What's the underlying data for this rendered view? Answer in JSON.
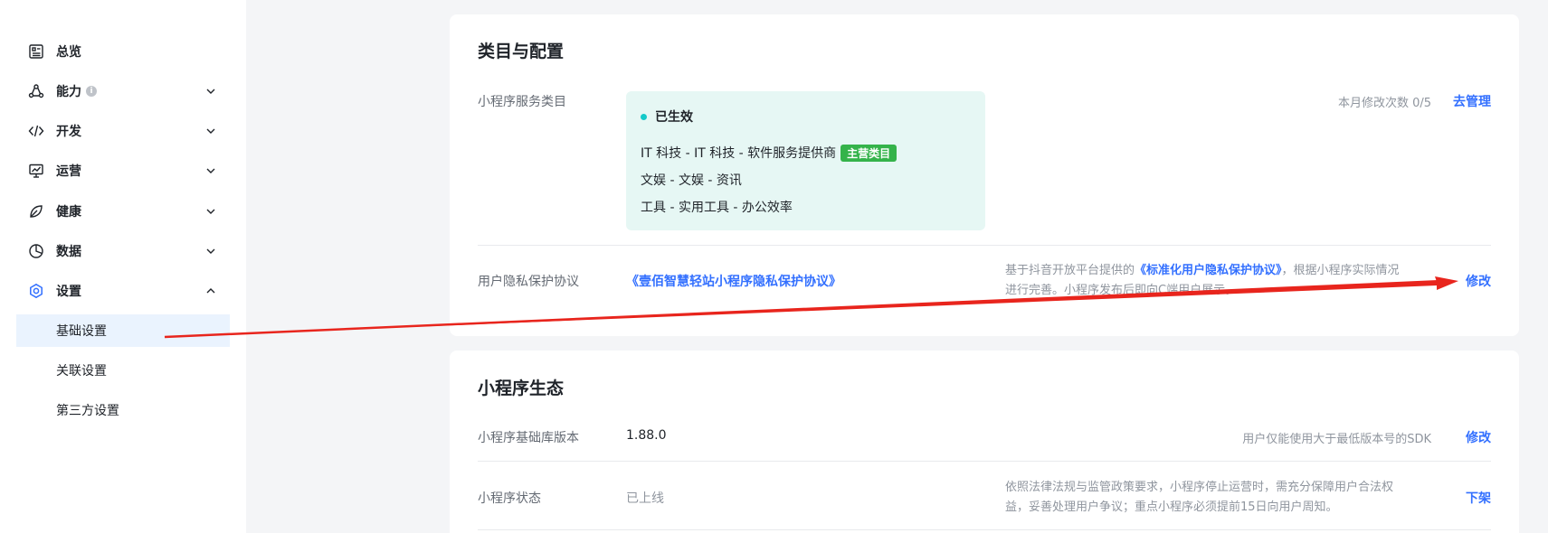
{
  "sidebar": {
    "items": [
      {
        "label": "总览",
        "icon": "dashboard-icon"
      },
      {
        "label": "能力",
        "icon": "capability-icon",
        "info": "i"
      },
      {
        "label": "开发",
        "icon": "code-icon"
      },
      {
        "label": "运营",
        "icon": "operation-icon"
      },
      {
        "label": "健康",
        "icon": "health-icon"
      },
      {
        "label": "数据",
        "icon": "pie-chart-icon"
      },
      {
        "label": "设置",
        "icon": "gear-icon"
      }
    ],
    "sub_items": [
      {
        "label": "基础设置",
        "active": true
      },
      {
        "label": "关联设置"
      },
      {
        "label": "第三方设置"
      }
    ]
  },
  "category_card": {
    "title": "类目与配置",
    "service_category": {
      "label": "小程序服务类目",
      "status": "已生效",
      "lines": [
        {
          "text": "IT 科技 - IT 科技 - 软件服务提供商",
          "badge": "主营类目"
        },
        {
          "text": "文娱 - 文娱 - 资讯"
        },
        {
          "text": "工具 - 实用工具 - 办公效率"
        }
      ],
      "monthly_changes": "本月修改次数 0/5",
      "action": "去管理"
    },
    "privacy": {
      "label": "用户隐私保护协议",
      "link": "《壹佰智慧轻站小程序隐私保护协议》",
      "desc_prefix": "基于抖音开放平台提供的",
      "desc_link": "《标准化用户隐私保护协议》",
      "desc_suffix": "，根据小程序实际情况",
      "desc_line2": "进行完善。小程序发布后即向C端用户展示。",
      "action": "修改"
    }
  },
  "ecosystem_card": {
    "title": "小程序生态",
    "sdk": {
      "label": "小程序基础库版本",
      "value": "1.88.0",
      "desc": "用户仅能使用大于最低版本号的SDK",
      "action": "修改"
    },
    "status": {
      "label": "小程序状态",
      "value": "已上线",
      "desc_line1": "依照法律法规与监管政策要求，小程序停止运营时，需充分保障用户合法权",
      "desc_line2": "益，妥善处理用户争议；重点小程序必须提前15日向用户周知。",
      "action": "下架"
    }
  },
  "colors": {
    "accent": "#3370ff",
    "badge": "#34b34a",
    "status_dot": "#14c9c9",
    "annotation_arrow": "#e8251d"
  }
}
